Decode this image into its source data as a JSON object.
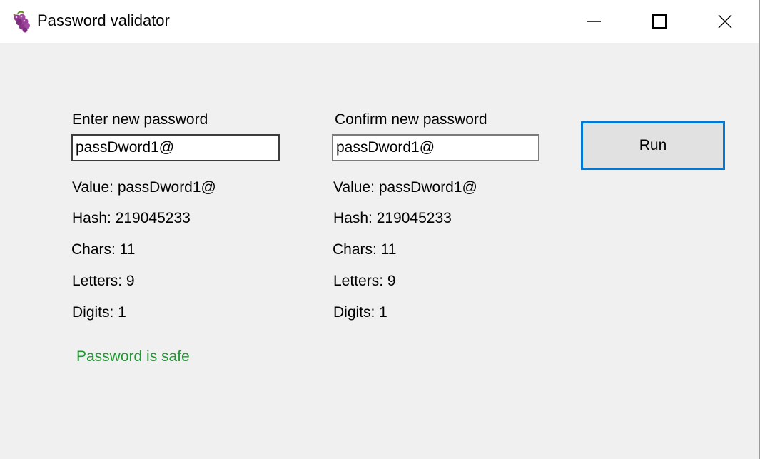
{
  "window": {
    "title": "Password validator",
    "icon": "grapes-icon",
    "controls": {
      "minimize": "minimize-icon",
      "maximize": "maximize-icon",
      "close": "close-icon"
    }
  },
  "left": {
    "label": "Enter new password",
    "input_value": "passDword1@",
    "value_text": "Value: passDword1@",
    "hash_text": "Hash: 219045233",
    "chars_text": "Chars: 11",
    "letters_text": "Letters: 9",
    "digits_text": "Digits: 1"
  },
  "right": {
    "label": "Confirm new password",
    "input_value": "passDword1@",
    "value_text": "Value: passDword1@",
    "hash_text": "Hash: 219045233",
    "chars_text": "Chars: 11",
    "letters_text": "Letters: 9",
    "digits_text": "Digits: 1"
  },
  "run_button_label": "Run",
  "status": {
    "text": "Password is safe",
    "color": "#1e9a32"
  },
  "colors": {
    "accent": "#0078d7",
    "client_bg": "#f0f0f0",
    "button_bg": "#e1e1e1"
  }
}
